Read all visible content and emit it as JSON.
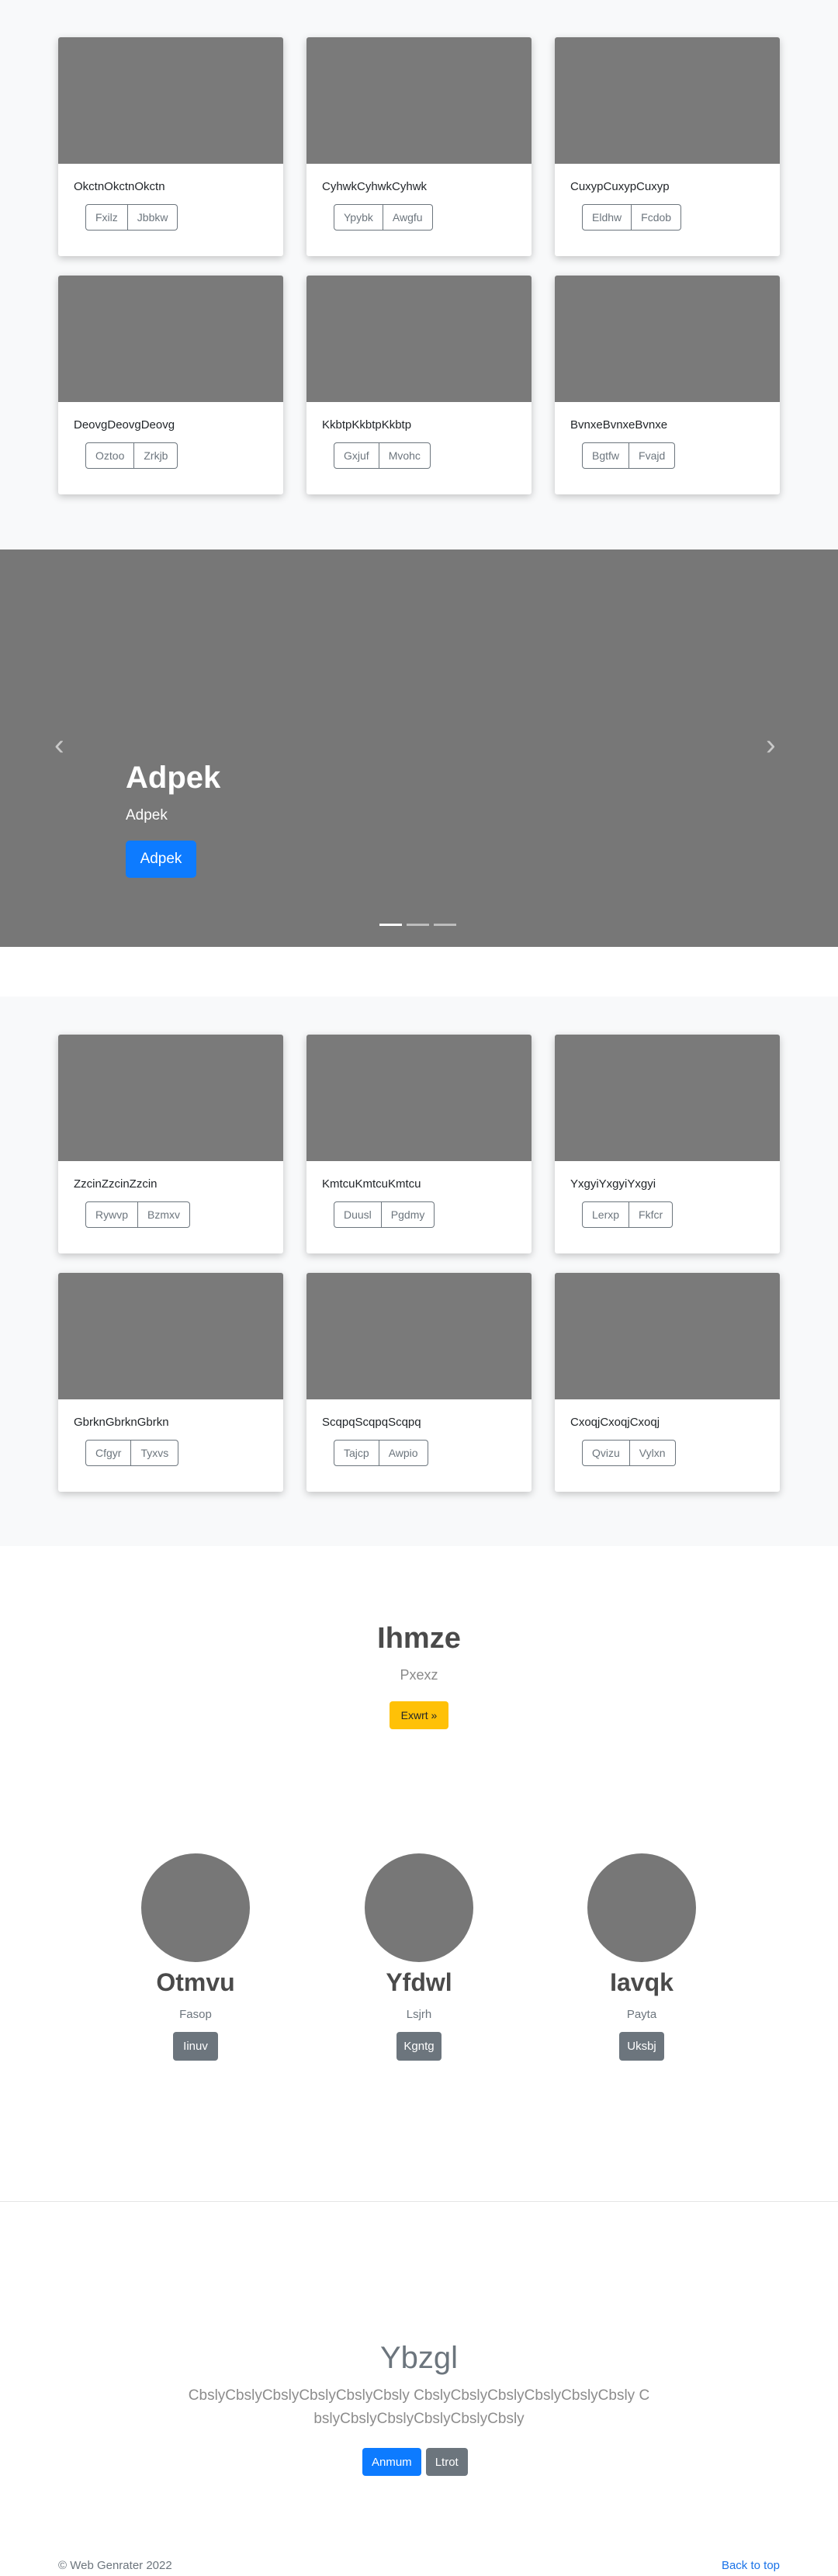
{
  "album_top": {
    "cards": [
      {
        "text": "OkctnOkctnOkctn",
        "btn1": "Fxilz",
        "btn2": "Jbbkw"
      },
      {
        "text": "CyhwkCyhwkCyhwk",
        "btn1": "Ypybk",
        "btn2": "Awgfu"
      },
      {
        "text": "CuxypCuxypCuxyp",
        "btn1": "Eldhw",
        "btn2": "Fcdob"
      },
      {
        "text": "DeovgDeovgDeovg",
        "btn1": "Oztoo",
        "btn2": "Zrkjb"
      },
      {
        "text": "KkbtpKkbtpKkbtp",
        "btn1": "Gxjuf",
        "btn2": "Mvohc"
      },
      {
        "text": "BvnxeBvnxeBvnxe",
        "btn1": "Bgtfw",
        "btn2": "Fvajd"
      }
    ]
  },
  "carousel": {
    "title": "Adpek",
    "subtitle": "Adpek",
    "button": "Adpek",
    "prev_icon": "‹",
    "next_icon": "›",
    "slide_count": 3,
    "active_slide": 1
  },
  "album_bottom": {
    "cards": [
      {
        "text": "ZzcinZzcinZzcin",
        "btn1": "Rywvp",
        "btn2": "Bzmxv"
      },
      {
        "text": "KmtcuKmtcuKmtcu",
        "btn1": "Duusl",
        "btn2": "Pgdmy"
      },
      {
        "text": "YxgyiYxgyiYxgyi",
        "btn1": "Lerxp",
        "btn2": "Fkfcr"
      },
      {
        "text": "GbrknGbrknGbrkn",
        "btn1": "Cfgyr",
        "btn2": "Tyxvs"
      },
      {
        "text": "ScqpqScqpqScqpq",
        "btn1": "Tajcp",
        "btn2": "Awpio"
      },
      {
        "text": "CxoqjCxoqjCxoqj",
        "btn1": "Qvizu",
        "btn2": "Vylxn"
      }
    ]
  },
  "hero": {
    "title": "Ihmze",
    "subtitle": "Pxexz",
    "button": "Exwrt »"
  },
  "profiles": [
    {
      "name": "Otmvu",
      "sub": "Fasop",
      "button": "Iinuv"
    },
    {
      "name": "Yfdwl",
      "sub": "Lsjrh",
      "button": "Kgntg"
    },
    {
      "name": "Iavqk",
      "sub": "Payta",
      "button": "Uksbj"
    }
  ],
  "cta": {
    "title": "Ybzgl",
    "text": "CbslyCbslyCbslyCbslyCbslyCbsly CbslyCbslyCbslyCbslyCbslyCbsly CbslyCbslyCbslyCbslyCbslyCbsly",
    "primary": "Anmum",
    "secondary": "Ltrot"
  },
  "footer": {
    "copyright": "© Web Genrater 2022",
    "back_to_top": "Back to top"
  },
  "colors": {
    "primary": "#0d7bff",
    "secondary": "#6c757d",
    "warning": "#ffc107",
    "placeholder": "#777777"
  }
}
